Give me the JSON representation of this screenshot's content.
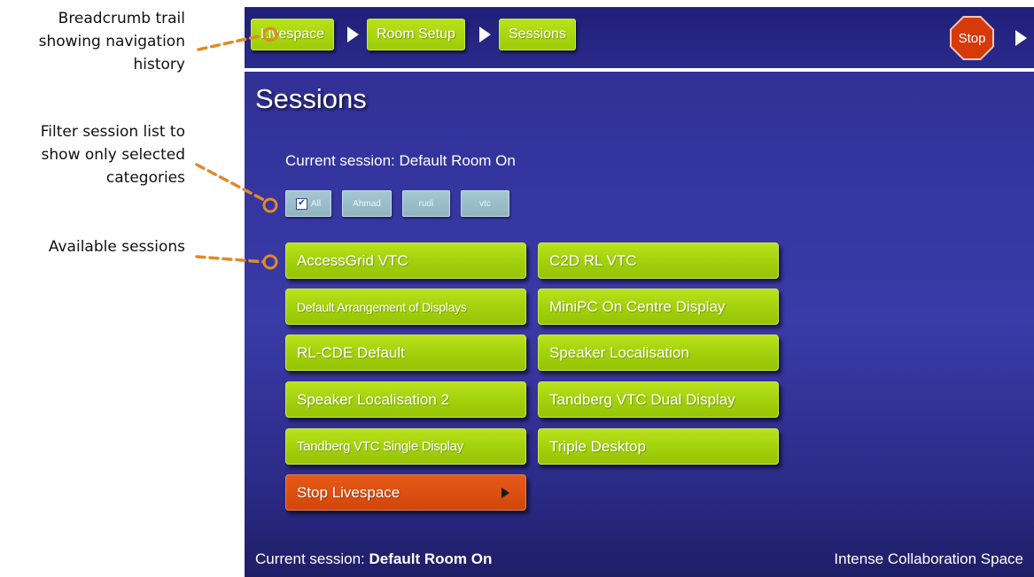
{
  "annotations": {
    "breadcrumb": [
      "Breadcrumb trail",
      "showing navigation",
      "history"
    ],
    "filter": [
      "Filter session list to",
      "show only selected",
      "categories"
    ],
    "sessions": [
      "Available sessions"
    ]
  },
  "breadcrumb": {
    "items": [
      "Livespace",
      "Room Setup",
      "Sessions"
    ],
    "stop_label": "Stop"
  },
  "page": {
    "title": "Sessions",
    "current_session_label": "Current session:",
    "current_session_value": "Default Room On"
  },
  "filters": [
    {
      "label": "All",
      "checked": true
    },
    {
      "label": "Ahmad",
      "checked": false
    },
    {
      "label": "rudi",
      "checked": false
    },
    {
      "label": "vtc",
      "checked": false
    }
  ],
  "sessions": [
    "AccessGrid VTC",
    "C2D RL VTC",
    "Default Arrangement of Displays",
    "MiniPC On Centre Display",
    "RL-CDE Default",
    "Speaker Localisation",
    "Speaker Localisation 2",
    "Tandberg VTC Dual Display",
    "Tandberg VTC Single Display",
    "Triple Desktop"
  ],
  "stop_livespace_label": "Stop Livespace",
  "footer": {
    "current_label": "Current session:",
    "current_value": "Default Room On",
    "brand": "Intense Collaboration Space"
  },
  "colors": {
    "accent_green": "#a2d00c",
    "stop_orange": "#d63a0a",
    "annotation_orange": "#e08a2c",
    "panel_blue": "#34349e"
  }
}
